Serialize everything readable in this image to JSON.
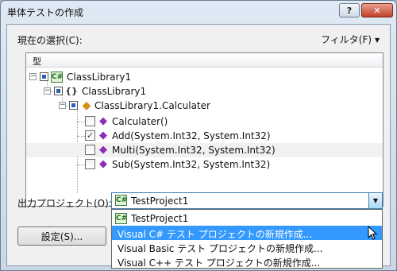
{
  "window": {
    "title": "単体テストの作成",
    "help_label": "?",
    "close_label": "✕"
  },
  "selection": {
    "label": "現在の選択(C):",
    "filter_label": "フィルタ(F)",
    "filter_arrow": "▼"
  },
  "tree": {
    "header": "型",
    "rows": [
      {
        "label": "ClassLibrary1",
        "icon": "csharp-project-icon",
        "expand": "−"
      },
      {
        "label": "ClassLibrary1",
        "icon": "namespace-icon",
        "icon_glyph": "{}",
        "expand": "−"
      },
      {
        "label": "ClassLibrary1.Calculater",
        "icon": "class-icon",
        "icon_glyph": "◆",
        "expand": "−"
      },
      {
        "label": "Calculater()",
        "icon": "method-icon",
        "icon_glyph": "◆",
        "checked": false
      },
      {
        "label": "Add(System.Int32, System.Int32)",
        "icon": "method-icon",
        "icon_glyph": "◆",
        "checked": true
      },
      {
        "label": "Multi(System.Int32, System.Int32)",
        "icon": "method-icon",
        "icon_glyph": "◆",
        "checked": false
      },
      {
        "label": "Sub(System.Int32, System.Int32)",
        "icon": "method-icon",
        "icon_glyph": "◆",
        "checked": false
      }
    ],
    "check_mark": "✓",
    "project_glyph": "C#"
  },
  "output": {
    "label": "出力プロジェクト(O):",
    "value": "TestProject1",
    "arrow": "▼"
  },
  "settings_button": "設定(S)...",
  "dropdown": {
    "items": [
      "TestProject1",
      "Visual  C# テスト プロジェクトの新規作成...",
      "Visual  Basic テスト プロジェクトの新規作成...",
      "Visual  C++ テスト プロジェクトの新規作成..."
    ],
    "selected_index": 1
  },
  "colors": {
    "selection": "#3399ff",
    "close_button": "#c2402a"
  }
}
